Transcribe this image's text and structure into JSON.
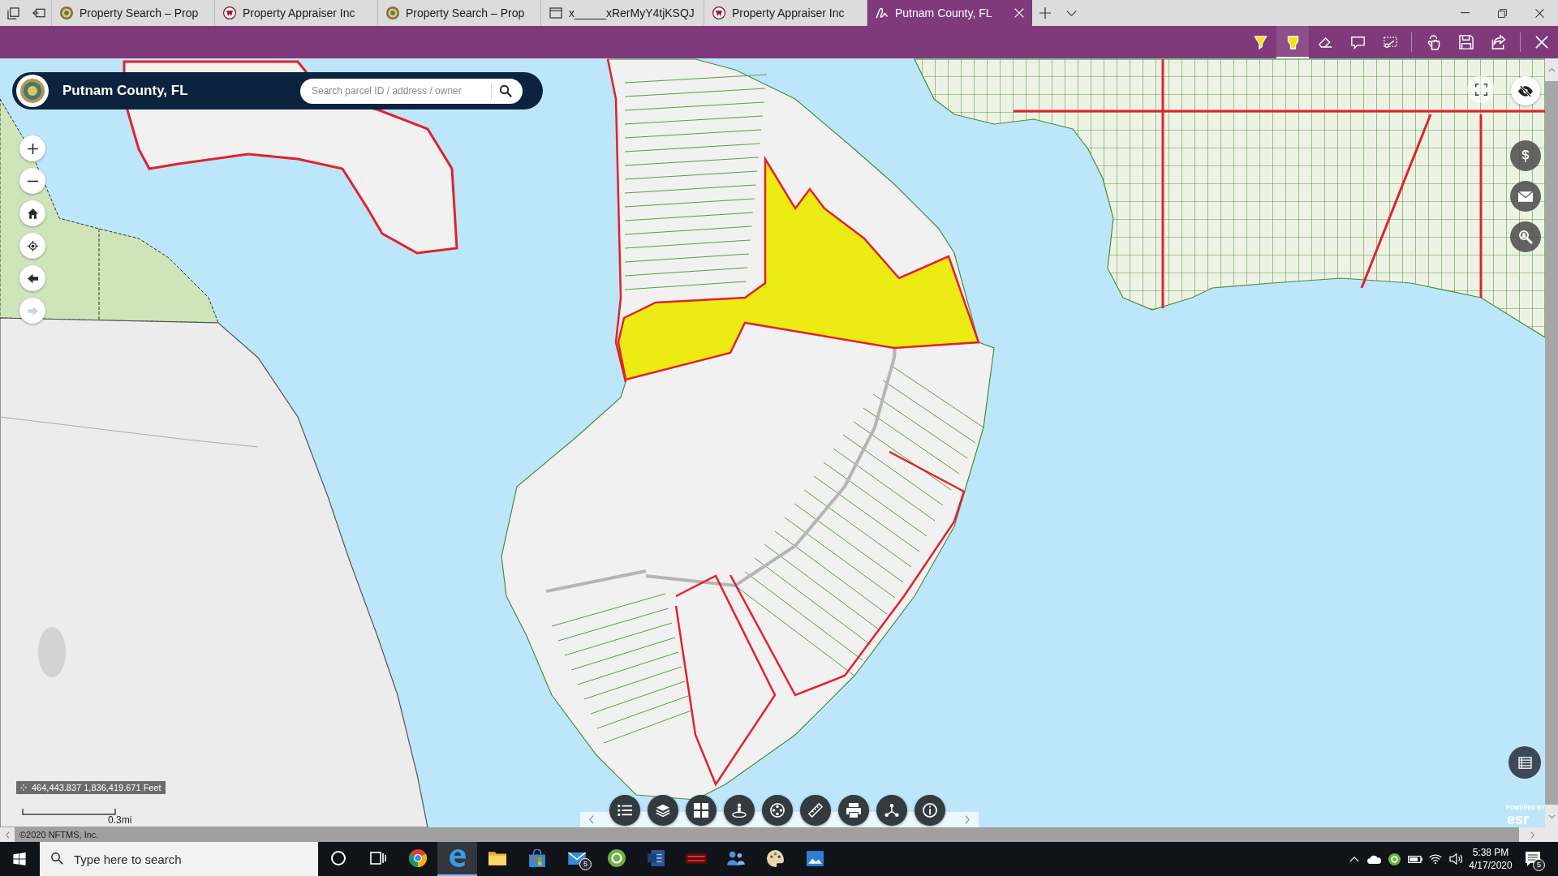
{
  "browser": {
    "tabs": [
      {
        "kind": "seal",
        "title": "Property Search – Prop",
        "selected": false
      },
      {
        "kind": "shield",
        "title": "Property Appraiser Inc",
        "selected": false
      },
      {
        "kind": "seal",
        "title": "Property Search – Prop",
        "selected": false
      },
      {
        "kind": "page",
        "title": "x_____xRerMyY4tjKSQJ",
        "selected": false
      },
      {
        "kind": "shield",
        "title": "Property Appraiser Inc",
        "selected": false
      },
      {
        "kind": "note",
        "title": "Putnam County, FL",
        "selected": true
      }
    ]
  },
  "note_toolbar": {
    "tools": [
      {
        "kind": "pen",
        "selected": false
      },
      {
        "kind": "highlighter",
        "selected": true
      },
      {
        "kind": "eraser",
        "selected": false
      },
      {
        "kind": "comment",
        "selected": false
      },
      {
        "kind": "clip",
        "selected": false
      }
    ]
  },
  "app_header": {
    "title": "Putnam County, FL",
    "search": {
      "placeholder": "Search parcel ID / address / owner"
    }
  },
  "map": {
    "nav": [
      {
        "kind": "zoom-in",
        "disabled": false
      },
      {
        "kind": "zoom-out",
        "disabled": false
      },
      {
        "kind": "home",
        "disabled": false
      },
      {
        "kind": "locate",
        "disabled": false
      },
      {
        "kind": "back",
        "disabled": false
      },
      {
        "kind": "forward",
        "disabled": true
      }
    ],
    "coordinates": "464,443.837 1,836,419.671 Feet",
    "scale": "0.3mi",
    "logo": {
      "tagline": "POWERED BY",
      "wordmark": "esr"
    },
    "attribution": "©2020 NFTMS, Inc."
  },
  "taskbar": {
    "search": {
      "placeholder": "Type here to search"
    },
    "apps": [
      {
        "kind": "ring",
        "selected": false
      },
      {
        "kind": "task-view",
        "selected": false
      },
      {
        "kind": "round-browser",
        "selected": false
      },
      {
        "kind": "browser",
        "selected": true
      },
      {
        "kind": "folder",
        "selected": false
      },
      {
        "kind": "bag",
        "selected": false
      },
      {
        "kind": "mail",
        "selected": false,
        "badge": "5"
      },
      {
        "kind": "circle-app",
        "selected": false
      },
      {
        "kind": "document",
        "selected": false
      },
      {
        "kind": "banner",
        "selected": false
      },
      {
        "kind": "people",
        "selected": false
      },
      {
        "kind": "palette",
        "selected": false
      },
      {
        "kind": "picture",
        "selected": false
      }
    ],
    "clock": {
      "time": "5:38 PM",
      "date": "4/17/2020"
    },
    "notifications": "5"
  }
}
